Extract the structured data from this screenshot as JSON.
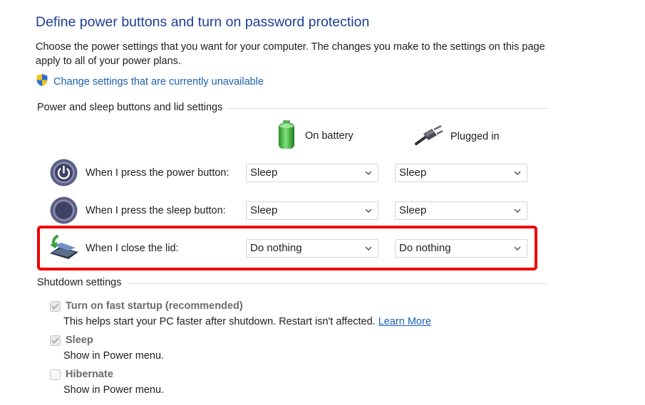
{
  "page": {
    "title": "Define power buttons and turn on password protection",
    "description": "Choose the power settings that you want for your computer. The changes you make to the settings on this page apply to all of your power plans.",
    "uac_link": "Change settings that are currently unavailable"
  },
  "power_section": {
    "heading": "Power and sleep buttons and lid settings",
    "columns": {
      "battery": "On battery",
      "plugged": "Plugged in"
    },
    "rows": [
      {
        "label": "When I press the power button:",
        "icon": "power-button-icon",
        "battery": "Sleep",
        "plugged": "Sleep"
      },
      {
        "label": "When I press the sleep button:",
        "icon": "sleep-button-icon",
        "battery": "Sleep",
        "plugged": "Sleep"
      },
      {
        "label": "When I close the lid:",
        "icon": "laptop-lid-icon",
        "battery": "Do nothing",
        "plugged": "Do nothing"
      }
    ]
  },
  "shutdown_section": {
    "heading": "Shutdown settings",
    "fast_startup": {
      "label": "Turn on fast startup (recommended)",
      "checked": true,
      "description": "This helps start your PC faster after shutdown. Restart isn't affected.",
      "link": "Learn More"
    },
    "sleep": {
      "label": "Sleep",
      "checked": true,
      "description": "Show in Power menu."
    },
    "hibernate": {
      "label": "Hibernate",
      "checked": false,
      "description": "Show in Power menu."
    }
  },
  "colors": {
    "title": "#1c3f94",
    "link": "#1a5fb4",
    "highlight": "#ee0000",
    "battery": "#3cb043"
  }
}
